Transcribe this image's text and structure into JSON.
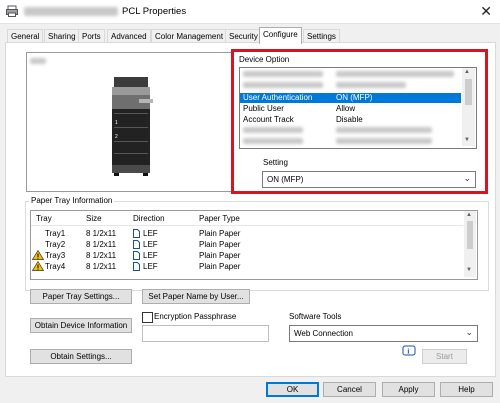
{
  "window": {
    "title": "PCL Properties",
    "close_glyph": "✕"
  },
  "tabs": [
    {
      "label": "General"
    },
    {
      "label": "Sharing"
    },
    {
      "label": "Ports"
    },
    {
      "label": "Advanced"
    },
    {
      "label": "Color Management"
    },
    {
      "label": "Security"
    },
    {
      "label": "Configure",
      "active": true
    },
    {
      "label": "Settings"
    }
  ],
  "device_option": {
    "label": "Device Option",
    "rows": [
      {
        "key": "User Authentication",
        "value": "ON (MFP)",
        "selected": true
      },
      {
        "key": "Public User",
        "value": "Allow"
      },
      {
        "key": "Account Track",
        "value": "Disable"
      }
    ],
    "setting_label": "Setting",
    "setting_value": "ON (MFP)"
  },
  "paper_tray": {
    "title": "Paper Tray Information",
    "columns": [
      "Tray",
      "Size",
      "Direction",
      "Paper Type"
    ],
    "rows": [
      {
        "tray": "Tray1",
        "size": "8 1/2x11",
        "direction": "LEF",
        "type": "Plain Paper",
        "warning": false
      },
      {
        "tray": "Tray2",
        "size": "8 1/2x11",
        "direction": "LEF",
        "type": "Plain Paper",
        "warning": false
      },
      {
        "tray": "Tray3",
        "size": "8 1/2x11",
        "direction": "LEF",
        "type": "Plain Paper",
        "warning": true
      },
      {
        "tray": "Tray4",
        "size": "8 1/2x11",
        "direction": "LEF",
        "type": "Plain Paper",
        "warning": true
      }
    ]
  },
  "buttons": {
    "paper_tray_settings": "Paper Tray Settings...",
    "set_paper_name": "Set Paper Name by User...",
    "obtain_device_info": "Obtain Device Information",
    "obtain_settings": "Obtain Settings...",
    "start": "Start",
    "ok": "OK",
    "cancel": "Cancel",
    "apply": "Apply",
    "help": "Help"
  },
  "encryption": {
    "label": "Encryption Passphrase",
    "checked": false,
    "value": ""
  },
  "software_tools": {
    "label": "Software Tools",
    "value": "Web Connection"
  },
  "icons": {
    "app": "printer-icon",
    "warning": "warning-icon",
    "paper": "paper-direction-icon",
    "info": "info-icon",
    "dropdown": "chevron-down-icon"
  },
  "colors": {
    "highlight": "#0078d7",
    "callout": "#d7141f",
    "warning": "#f2c200"
  }
}
